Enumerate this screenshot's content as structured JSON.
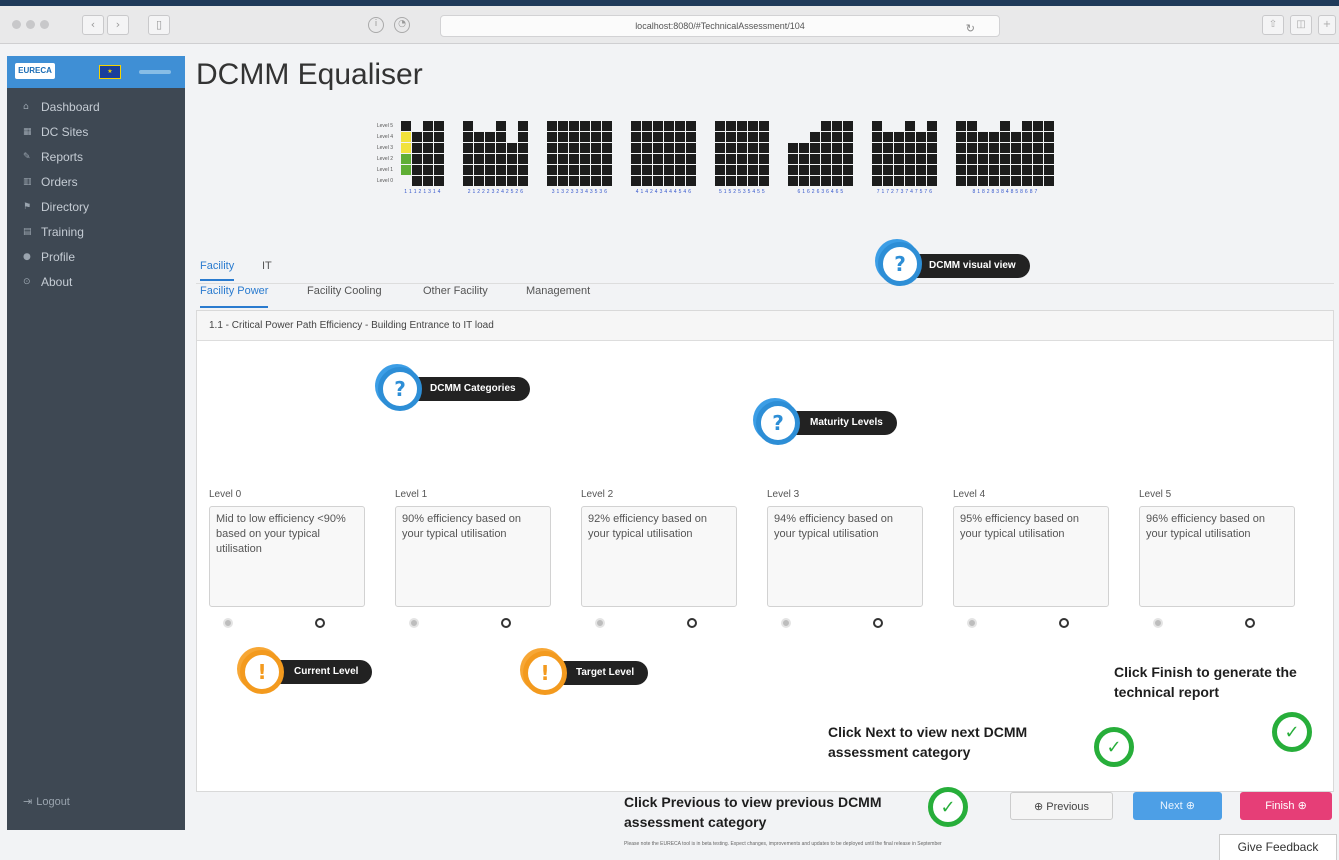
{
  "browser": {
    "url": "localhost:8080/#TechnicalAssessment/104"
  },
  "sidebar": {
    "logo_text": "EURECA",
    "items": [
      {
        "icon": "home-icon",
        "glyph": "⌂",
        "label": "Dashboard"
      },
      {
        "icon": "building-icon",
        "glyph": "▦",
        "label": "DC Sites"
      },
      {
        "icon": "edit-icon",
        "glyph": "✎",
        "label": "Reports"
      },
      {
        "icon": "chart-icon",
        "glyph": "▥",
        "label": "Orders"
      },
      {
        "icon": "flag-icon",
        "glyph": "⚑",
        "label": "Directory"
      },
      {
        "icon": "book-icon",
        "glyph": "▤",
        "label": "Training"
      },
      {
        "icon": "user-icon",
        "glyph": "●",
        "label": "Profile"
      },
      {
        "icon": "info-icon",
        "glyph": "⊙",
        "label": "About"
      }
    ],
    "logout_label": "Logout"
  },
  "page": {
    "title": "DCMM Equaliser"
  },
  "equaliser": {
    "level_labels": [
      "Level 5",
      "Level 4",
      "Level 3",
      "Level 2",
      "Level 1",
      "Level 0"
    ],
    "groups": [
      {
        "label": "1 1 1 2 1 3 1 4",
        "heights": [
          6,
          5,
          6,
          6
        ],
        "current_colors": true
      },
      {
        "label": "2 1 2 2 2 3 2 4 2 5 2 6",
        "heights": [
          6,
          5,
          5,
          6,
          4,
          6
        ]
      },
      {
        "label": "3 1 3 2 3 3 3 4 3 5 3 6",
        "heights": [
          6,
          6,
          6,
          6,
          6,
          6
        ]
      },
      {
        "label": "4 1 4 2 4 3 4 4 4 5 4 6",
        "heights": [
          6,
          6,
          6,
          6,
          6,
          6
        ]
      },
      {
        "label": "5 1 5 2 5 3 5 4 5 5",
        "heights": [
          6,
          6,
          6,
          6,
          6
        ]
      },
      {
        "label": "6 1 6 2 6 3 6 4 6 5",
        "heights": [
          4,
          4,
          5,
          6,
          6,
          6
        ]
      },
      {
        "label": "7 1 7 2 7 3 7 4 7 5 7 6",
        "heights": [
          6,
          5,
          5,
          6,
          5,
          6
        ]
      },
      {
        "label": "8 1 8 2 8 3 8 4 8 5 8 6 8 7",
        "heights": [
          6,
          6,
          5,
          5,
          6,
          5,
          6,
          6,
          6
        ]
      }
    ]
  },
  "tabs": {
    "main": [
      "Facility",
      "IT"
    ],
    "sub": [
      "Facility Power",
      "Facility Cooling",
      "Other Facility",
      "Management"
    ]
  },
  "question": {
    "title": "1.1 - Critical Power Path Efficiency - Building Entrance to IT load"
  },
  "levels": [
    {
      "name": "Level 0",
      "text": "Mid to low efficiency <90% based on your typical utilisation"
    },
    {
      "name": "Level 1",
      "text": "90% efficiency based on your typical utilisation"
    },
    {
      "name": "Level 2",
      "text": "92% efficiency based on your typical utilisation"
    },
    {
      "name": "Level 3",
      "text": "94% efficiency based on your typical utilisation"
    },
    {
      "name": "Level 4",
      "text": "95% efficiency based on your typical utilisation"
    },
    {
      "name": "Level 5",
      "text": "96% efficiency based on your typical utilisation"
    }
  ],
  "tooltips": {
    "visual_view": "DCMM visual view",
    "categories": "DCMM Categories",
    "maturity": "Maturity Levels",
    "current": "Current Level",
    "target": "Target Level"
  },
  "instructions": {
    "finish": "Click Finish to generate the technical report",
    "next": "Click Next to view next DCMM assessment category",
    "previous": "Click Previous to view previous DCMM assessment category"
  },
  "buttons": {
    "previous": "⊕ Previous",
    "next": "Next ⊕",
    "finish": "Finish ⊕",
    "feedback": "Give Feedback"
  },
  "footer_note": "Please note the EURECA tool is in beta testing. Expect changes, improvements and updates to be deployed until the final release in September",
  "colors": {
    "accent": "#2a7bcf",
    "next": "#4d9fe6",
    "finish": "#e63e77",
    "sidebar": "#3e4853"
  }
}
